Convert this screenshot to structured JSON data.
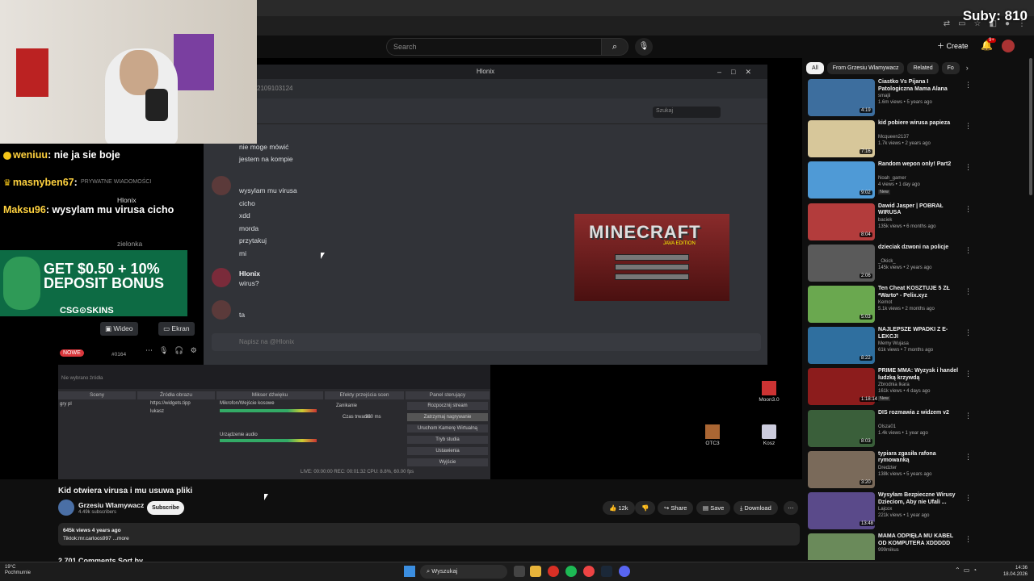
{
  "stream_overlay": {
    "subs_counter": "Suby: 810",
    "chat": [
      {
        "user": "weniuu",
        "message": "nie ja sie boje"
      },
      {
        "user": "masnyben67",
        "message": ""
      },
      {
        "user": "Maksu96",
        "message": "wysylam mu virusa cicho"
      }
    ],
    "ad": {
      "headline": "GET $0.50 + 10% DEPOSIT BONUS",
      "line1": "GET $0.50 + 10%",
      "line2": "DEPOSIT BONUS",
      "brand": "CSG⊙SKINS"
    }
  },
  "youtube_header": {
    "search_placeholder": "Search",
    "create_label": "Create",
    "notification_count": "9+"
  },
  "discord": {
    "window_title": "Hlonix",
    "url_fragment": "2109103124",
    "search_placeholder": "Szukaj",
    "dm_header": "PRYWATNE WIADOMOŚCI",
    "dm_active": "Hlonix",
    "dm_other": "zielonka",
    "messages_block1": [
      "nie moge mówić",
      "jestem na kompie"
    ],
    "messages_block2": [
      "wysylam mu virusa",
      "cicho",
      "xdd",
      "morda",
      "przytakuj",
      "mi"
    ],
    "hlonix_author": "Hlonix",
    "hlonix_msg": "wirus?",
    "reply": "ta",
    "input_placeholder": "Napisz na @Hlonix",
    "video_btn": "Wideo",
    "screen_btn": "Ekran",
    "new_badge": "NOWE",
    "user_tag": "#0164",
    "minecraft_logo": "MINECRAFT",
    "minecraft_edition": "JAVA EDITION"
  },
  "obs": {
    "no_source": "Nie wybrano źródła",
    "panels": [
      "Sceny",
      "Źródła obrazu",
      "Mikser dźwięku",
      "Efekty przejścia scen",
      "Panel sterujący"
    ],
    "scene": "gry pl",
    "sources": [
      "https://widgets.tipp",
      "lukasz"
    ],
    "mixer": [
      "Mikrofon/Wejście kosowe",
      "Urządzenie audio"
    ],
    "transition": "Zanikanie",
    "duration_label": "Czas trwania",
    "duration": "300 ms",
    "controls": [
      "Rozpocznij stream",
      "Zatrzymaj nagrywanie",
      "Uruchom Kamerę Wirtualną",
      "Tryb studia",
      "Ustawienia",
      "Wyjście"
    ],
    "status": "LIVE: 00:00:00     REC: 00:01:32     CPU: 8.8%, 60.00 fps"
  },
  "desktop": {
    "icons": [
      "Moon3.0",
      "OTC3",
      "Kosz"
    ]
  },
  "video_info": {
    "title": "Kid otwiera virusa i mu usuwa pliki",
    "channel": "Grzesiu Wlamywacz",
    "subs": "4.49k subscribers",
    "subscribe": "Subscribe",
    "likes": "12k",
    "share": "Share",
    "save": "Save",
    "download": "Download",
    "views_line": "645k views  4 years ago",
    "desc_line": "Tiktok:mr.carloos997 ...more",
    "comments": "2,701 Comments     Sort by"
  },
  "related": {
    "chips": [
      "All",
      "From Grzesiu Wlamywacz",
      "Related",
      "Fo"
    ],
    "items": [
      {
        "title": "Ciastko Vs Pijana I Patologiczna Mama Alana",
        "channel": "smajii",
        "meta": "1.6m views • 5 years ago",
        "duration": "4:19",
        "color": "#3d6e9e",
        "new": ""
      },
      {
        "title": "kid pobiere wirusa papieza",
        "channel": "Mcqueen2137",
        "meta": "1.7k views • 2 years ago",
        "duration": "7:16",
        "color": "#d7c79a",
        "new": ""
      },
      {
        "title": "Random wepon only! Part2",
        "channel": "Noah_gamer",
        "meta": "4 views • 1 day ago",
        "duration": "9:02",
        "color": "#4f9ad6",
        "new": "New"
      },
      {
        "title": "Dawid Jasper | POBRAŁ WIRUSA",
        "channel": "baciek",
        "meta": "135k views • 6 months ago",
        "duration": "8:04",
        "color": "#b33c3c",
        "new": ""
      },
      {
        "title": "dzieciak dzwoni na policje",
        "channel": "_Okick_",
        "meta": "145k views • 2 years ago",
        "duration": "2:06",
        "color": "#5a5a5a",
        "new": ""
      },
      {
        "title": "Ten Cheat KOSZTUJE 5 ZŁ *Warto* - Pelix.xyz",
        "channel": "Kemot",
        "meta": "5.1k views • 2 months ago",
        "duration": "5:03",
        "color": "#6aa84f",
        "new": ""
      },
      {
        "title": "NAJLEPSZE WPADKI Z E-LEKCJI",
        "channel": "Memy Wujasa",
        "meta": "61k views • 7 months ago",
        "duration": "8:22",
        "color": "#2f6f9f",
        "new": ""
      },
      {
        "title": "PRIME MMA: Wyzysk i handel ludzką krzywdą",
        "channel": "Zbrodnia Ikara",
        "meta": "161k views • 4 days ago",
        "duration": "1:18:14",
        "color": "#8c1c1c",
        "new": "New"
      },
      {
        "title": "DIS rozmawia z widzem v2",
        "channel": "Olsza01",
        "meta": "1.4k views • 1 year ago",
        "duration": "8:03",
        "color": "#3a5f3a",
        "new": ""
      },
      {
        "title": "typiara zgasiła rafona rymowanką",
        "channel": "Dredzter",
        "meta": "138k views • 5 years ago",
        "duration": "3:20",
        "color": "#7a6a5a",
        "new": ""
      },
      {
        "title": "Wysyłam Bezpieczne Wirusy Dzieciom, Aby nie Ufali ...",
        "channel": "Lajcox",
        "meta": "221k views • 1 year ago",
        "duration": "13:48",
        "color": "#5a4a8a",
        "new": ""
      },
      {
        "title": "MAMA ODPIĘŁA MU KABEL OD KOMPUTERA XDDDDD",
        "channel": "999mikus",
        "meta": "",
        "duration": "",
        "color": "#6a8a5a",
        "new": ""
      }
    ]
  },
  "taskbar": {
    "weather_temp": "19°C",
    "weather_desc": "Pochmurnie",
    "search": "Wyszukaj",
    "time": "14:36",
    "date": "18.04.2026"
  }
}
